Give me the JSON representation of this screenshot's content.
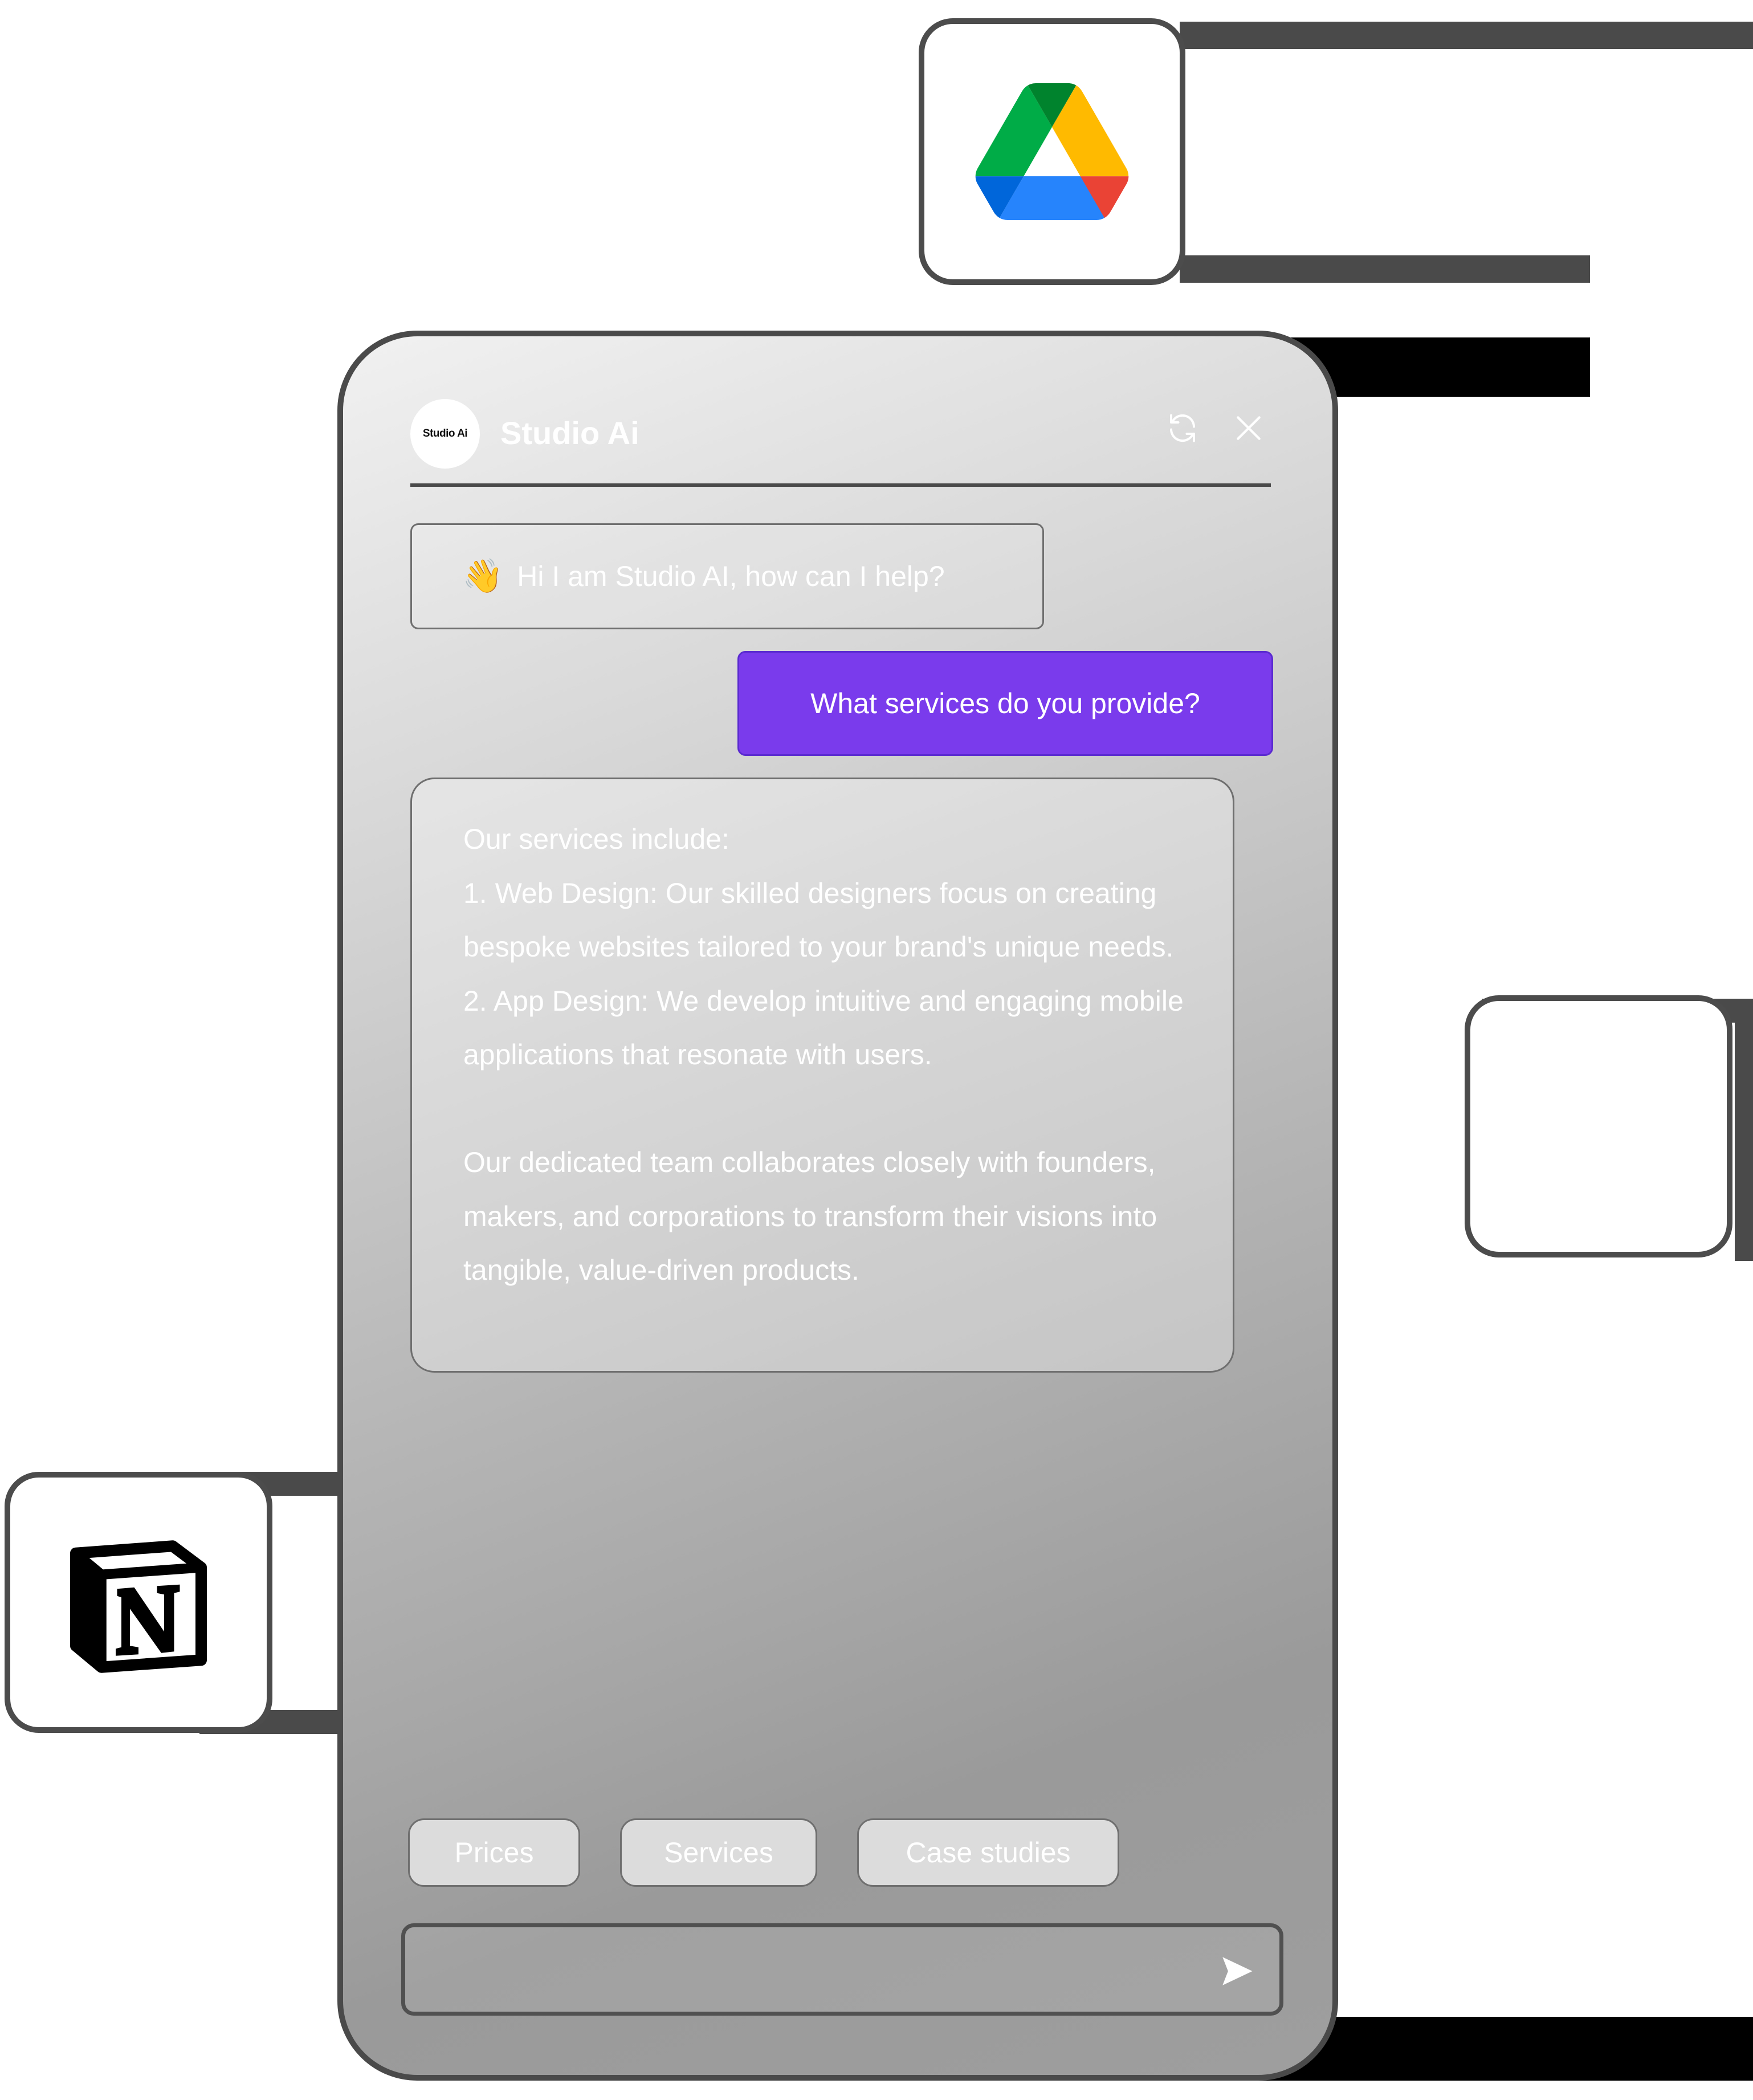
{
  "app": {
    "avatar_label": "Studio Ai",
    "title": "Studio Ai"
  },
  "header": {
    "refresh_icon": "refresh-icon",
    "close_icon": "close-icon"
  },
  "messages": [
    {
      "role": "bot",
      "emoji": "👋",
      "text": "Hi I am Studio AI, how can I help?"
    },
    {
      "role": "user",
      "text": "What services do you provide?"
    },
    {
      "role": "bot",
      "text": "Our services include:\n1. Web Design: Our skilled designers focus on creating bespoke websites tailored to your brand's unique needs.\n2. App Design: We develop intuitive and engaging mobile applications that resonate with users.\n\nOur dedicated team collaborates closely with founders, makers, and corporations to transform their visions into tangible, value-driven products."
    }
  ],
  "quick_replies": [
    "Prices",
    "Services",
    "Case studies"
  ],
  "composer": {
    "placeholder": "",
    "send_icon": "send-icon"
  },
  "integrations": {
    "top": "google-drive-icon",
    "left": "notion-icon",
    "right": "blank-tile"
  },
  "colors": {
    "user_bubble": "#7a3bec",
    "connector": "#4a4a4a",
    "frame": "#4a4a4a"
  }
}
